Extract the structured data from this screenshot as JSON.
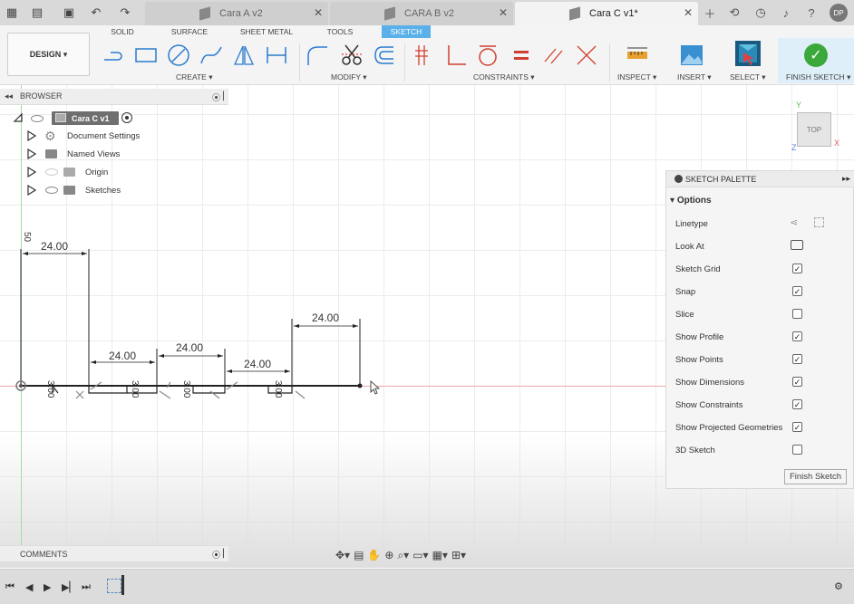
{
  "tabs": [
    {
      "label": "Cara A v2",
      "active": false
    },
    {
      "label": "CARA B v2",
      "active": false
    },
    {
      "label": "Cara C v1*",
      "active": true
    }
  ],
  "user_initials": "DP",
  "ribbon": {
    "workspace": "DESIGN",
    "tabs": [
      "SOLID",
      "SURFACE",
      "SHEET METAL",
      "TOOLS",
      "SKETCH"
    ],
    "active_tab": "SKETCH",
    "groups": [
      "CREATE",
      "MODIFY",
      "CONSTRAINTS",
      "INSPECT",
      "INSERT",
      "SELECT",
      "FINISH SKETCH"
    ]
  },
  "browser": {
    "title": "BROWSER",
    "root": "Cara C v1",
    "items": [
      "Document Settings",
      "Named Views",
      "Origin",
      "Sketches"
    ]
  },
  "palette": {
    "title": "SKETCH PALETTE",
    "section": "Options",
    "rows": [
      {
        "label": "Linetype",
        "type": "icons"
      },
      {
        "label": "Look At",
        "type": "icon"
      },
      {
        "label": "Sketch Grid",
        "checked": true
      },
      {
        "label": "Snap",
        "checked": true
      },
      {
        "label": "Slice",
        "checked": false
      },
      {
        "label": "Show Profile",
        "checked": true
      },
      {
        "label": "Show Points",
        "checked": true
      },
      {
        "label": "Show Dimensions",
        "checked": true
      },
      {
        "label": "Show Constraints",
        "checked": true
      },
      {
        "label": "Show Projected Geometries",
        "checked": true
      },
      {
        "label": "3D Sketch",
        "checked": false
      }
    ],
    "finish_button": "Finish Sketch"
  },
  "viewcube": {
    "face": "TOP",
    "axis_x": "X",
    "axis_y": "Y",
    "axis_z": "Z"
  },
  "sketch": {
    "dimensions": [
      "24.00",
      "24.00",
      "24.00",
      "24.00",
      "24.00"
    ],
    "small_dims": [
      "3.00",
      "3.00",
      "3.00",
      "3.00"
    ],
    "vertical_dim": "50"
  },
  "comments": {
    "title": "COMMENTS"
  },
  "colors": {
    "accent": "#5ab0e8",
    "finish": "#3aa83a",
    "red_axis": "#f0a8a8",
    "green_axis": "#a8d9a8"
  }
}
